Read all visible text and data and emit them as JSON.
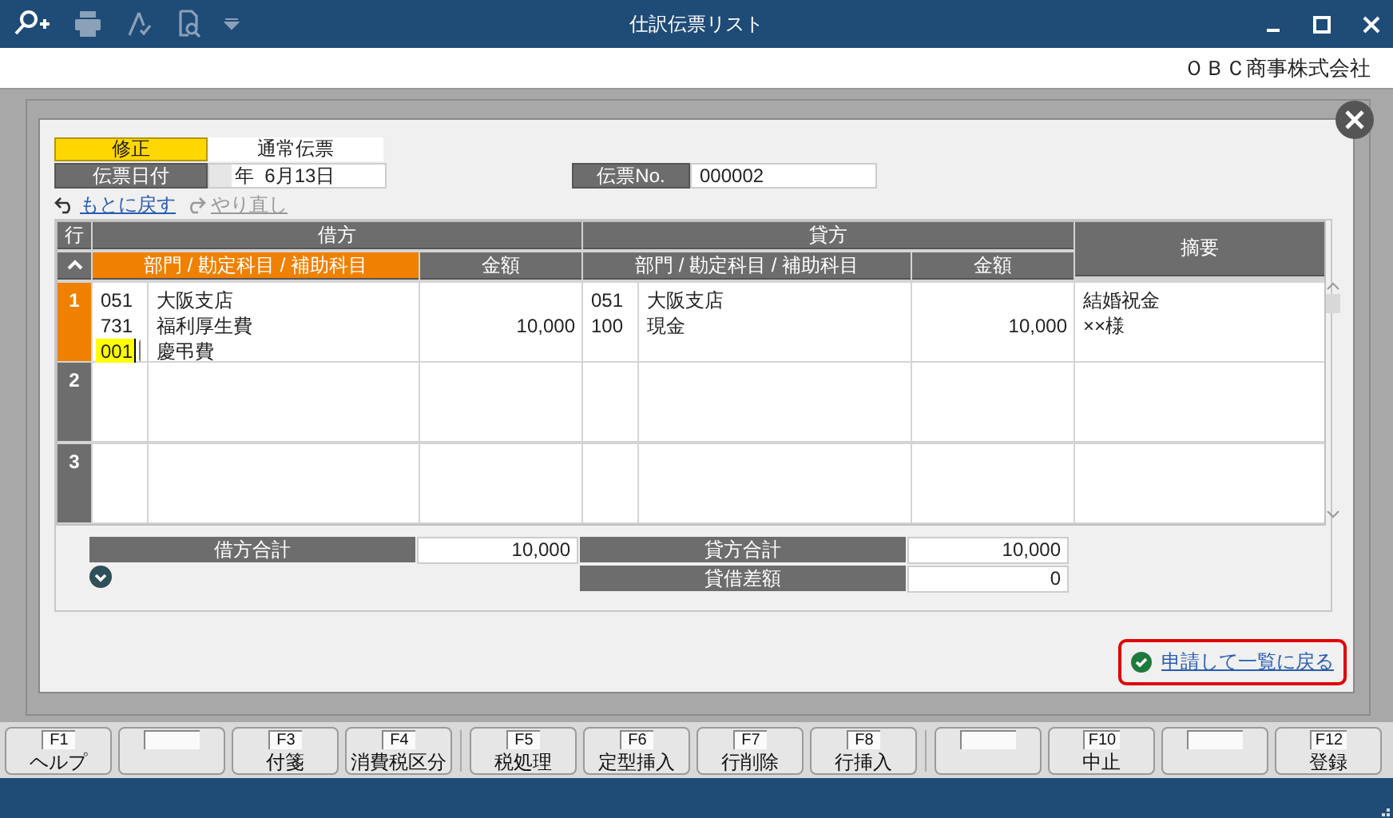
{
  "window": {
    "title": "仕訳伝票リスト"
  },
  "company": "ＯＢＣ商事株式会社",
  "dialog": {
    "mode": "修正",
    "slip_type": "通常伝票",
    "date_label": "伝票日付",
    "date_value": "年  6月13日",
    "slip_no_label": "伝票No.",
    "slip_no": "000002",
    "history": [
      {
        "kind": "undo",
        "label": "もとに戻す",
        "disabled": false
      },
      {
        "kind": "redo",
        "label": "やり直し",
        "disabled": true
      }
    ],
    "table": {
      "row_header": "行",
      "groups": [
        "借方",
        "貸方"
      ],
      "memo_header": "摘要",
      "columns": [
        {
          "label": "部門 / 勘定科目 / 補助科目",
          "selected": true
        },
        {
          "label": "金額",
          "selected": false
        },
        {
          "label": "部門 / 勘定科目 / 補助科目",
          "selected": false
        },
        {
          "label": "金額",
          "selected": false
        }
      ],
      "rows": [
        {
          "number": "1",
          "selected": true,
          "debit": {
            "lines": [
              {
                "code": "051",
                "name": "大阪支店",
                "editing": false
              },
              {
                "code": "731",
                "name": "福利厚生費",
                "editing": false
              },
              {
                "code": "001",
                "name": "慶弔費",
                "editing": true
              }
            ],
            "amount": "10,000"
          },
          "credit": {
            "lines": [
              {
                "code": "051",
                "name": "大阪支店",
                "editing": false
              },
              {
                "code": "100",
                "name": "現金",
                "editing": false
              }
            ],
            "amount": "10,000"
          },
          "memo": [
            "結婚祝金",
            "××様"
          ]
        },
        {
          "number": "2",
          "selected": false
        },
        {
          "number": "3",
          "selected": false
        }
      ]
    },
    "totals": [
      {
        "label": "借方合計",
        "value": "10,000"
      },
      {
        "label": "貸方合計",
        "value": "10,000"
      },
      {
        "label": "貸借差額",
        "value": "0"
      }
    ],
    "submit_link": "申請して一覧に戻る"
  },
  "function_keys": [
    {
      "kind": "key",
      "key": "F1",
      "label": "ヘルプ"
    },
    {
      "kind": "blank"
    },
    {
      "kind": "key",
      "key": "F3",
      "label": "付箋"
    },
    {
      "kind": "key",
      "key": "F4",
      "label": "消費税区分"
    },
    {
      "kind": "key",
      "key": "F5",
      "label": "税処理"
    },
    {
      "kind": "key",
      "key": "F6",
      "label": "定型挿入"
    },
    {
      "kind": "key",
      "key": "F7",
      "label": "行削除"
    },
    {
      "kind": "key",
      "key": "F8",
      "label": "行挿入"
    },
    {
      "kind": "blank"
    },
    {
      "kind": "key",
      "key": "F10",
      "label": "中止"
    },
    {
      "kind": "blank"
    },
    {
      "kind": "key",
      "key": "F12",
      "label": "登録"
    }
  ]
}
